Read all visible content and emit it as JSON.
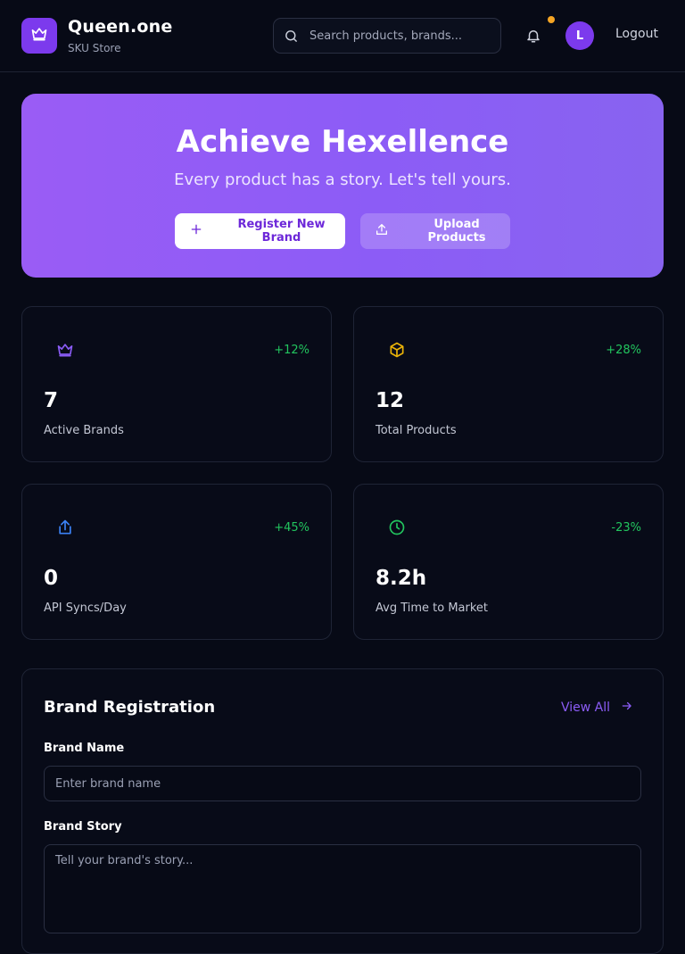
{
  "header": {
    "app_name": "Queen.one",
    "app_subtitle": "SKU Store",
    "search_placeholder": "Search products, brands...",
    "avatar_initial": "L",
    "logout_label": "Logout",
    "notification_dot_color": "#f5a524",
    "icons": [
      "crown-icon",
      "search-icon",
      "bell-icon"
    ]
  },
  "hero": {
    "title": "Achieve Hexellence",
    "subtitle": "Every product has a story. Let's tell yours.",
    "register_label": "Register New Brand",
    "upload_label": "Upload Products",
    "icons": [
      "plus-icon",
      "upload-icon"
    ]
  },
  "stats": [
    {
      "icon": "crown-icon",
      "icon_color": "#8b5cf6",
      "change": "+12%",
      "change_color": "#22c55e",
      "value": "7",
      "label": "Active Brands"
    },
    {
      "icon": "box-icon",
      "icon_color": "#eab308",
      "change": "+28%",
      "change_color": "#22c55e",
      "value": "12",
      "label": "Total Products"
    },
    {
      "icon": "share-icon",
      "icon_color": "#3b82f6",
      "change": "+45%",
      "change_color": "#22c55e",
      "value": "0",
      "label": "API Syncs/Day"
    },
    {
      "icon": "clock-icon",
      "icon_color": "#22c55e",
      "change": "-23%",
      "change_color": "#22c55e",
      "value": "8.2h",
      "label": "Avg Time to Market"
    }
  ],
  "registration": {
    "title": "Brand Registration",
    "view_all_label": "View All",
    "brand_name_label": "Brand Name",
    "brand_name_placeholder": "Enter brand name",
    "brand_name_value": "",
    "brand_story_label": "Brand Story",
    "brand_story_placeholder": "Tell your brand's story...",
    "brand_story_value": ""
  },
  "colors": {
    "accent": "#7c3aed",
    "background": "#070a16",
    "positive": "#22c55e"
  }
}
